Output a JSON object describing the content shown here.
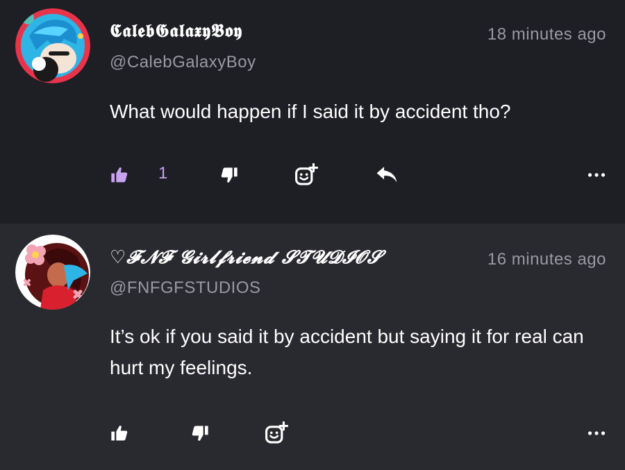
{
  "comments": [
    {
      "display_name": "𝕮𝖆𝖑𝖊𝖇𝕲𝖆𝖑𝖆𝖝𝖞𝕭𝖔𝖞",
      "handle": "@CalebGalaxyBoy",
      "timestamp": "18 minutes ago",
      "text": "What would happen if I said it by accident tho?",
      "like_count": "1",
      "liked": true,
      "has_reply": true,
      "avatar_icon": "avatar-blue-hair-character"
    },
    {
      "display_name": "♡𝓕𝓝𝓕 𝓖𝓲𝓻𝓵𝓯𝓻𝓲𝓮𝓷𝓭 𝓢𝓣𝓤𝓓𝓘𝓞𝓢",
      "handle": "@FNFGFSTUDIOS",
      "timestamp": "16 minutes ago",
      "text": "It’s ok if you said it by accident but saying it for real can hurt my feelings.",
      "like_count": "",
      "liked": false,
      "has_reply": false,
      "avatar_icon": "avatar-girlfriend-character-flowers"
    }
  ],
  "colors": {
    "liked_accent": "#c9a3f0",
    "icon_white": "#ffffff",
    "muted_text": "#9a9aa2"
  }
}
